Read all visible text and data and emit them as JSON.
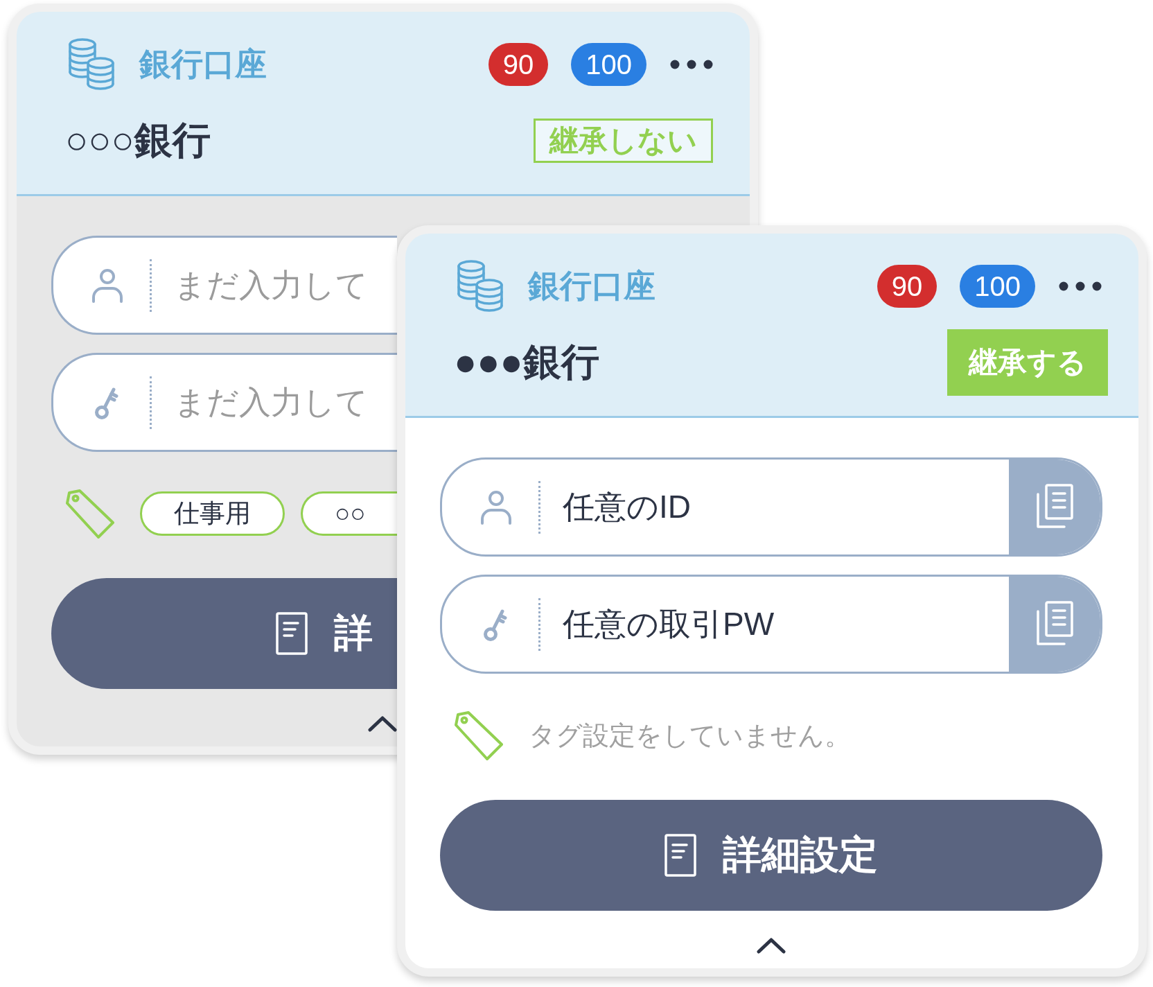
{
  "cards": [
    {
      "category": "銀行口座",
      "badges": [
        {
          "label": "90",
          "color": "#d32e2e"
        },
        {
          "label": "100",
          "color": "#2a7fe2"
        }
      ],
      "name": "○○○銀行",
      "inheritance": {
        "label": "継承しない",
        "on": false
      },
      "fields": [
        {
          "kind": "id",
          "placeholder": "まだ入力して"
        },
        {
          "kind": "password",
          "placeholder": "まだ入力して"
        }
      ],
      "tags": [
        {
          "label": "仕事用"
        },
        {
          "label": "○○"
        }
      ],
      "detail_button": "詳"
    },
    {
      "category": "銀行口座",
      "badges": [
        {
          "label": "90",
          "color": "#d32e2e"
        },
        {
          "label": "100",
          "color": "#2a7fe2"
        }
      ],
      "name": "●●●銀行",
      "inheritance": {
        "label": "継承する",
        "on": true
      },
      "fields": [
        {
          "kind": "id",
          "value": "任意のID",
          "copy": true
        },
        {
          "kind": "password",
          "value": "任意の取引PW",
          "copy": true
        }
      ],
      "no_tags_message": "タグ設定をしていません。",
      "detail_button": "詳細設定"
    }
  ]
}
